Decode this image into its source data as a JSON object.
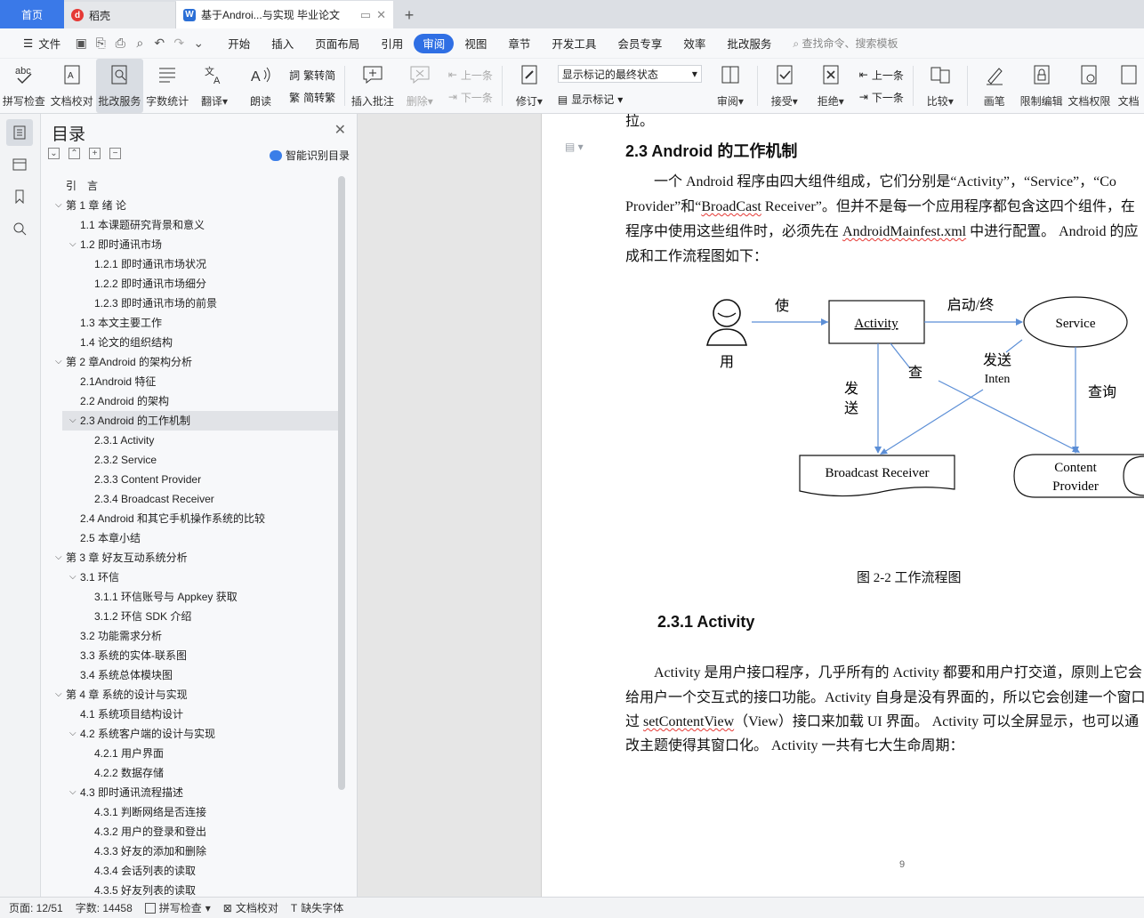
{
  "tabs": {
    "home": "首页",
    "daoke": "稻壳",
    "doc": "基于Androi...与实现 毕业论文",
    "new": "+"
  },
  "menu": {
    "file": "文件",
    "items": [
      "开始",
      "插入",
      "页面布局",
      "引用",
      "审阅",
      "视图",
      "章节",
      "开发工具",
      "会员专享",
      "效率",
      "批改服务"
    ],
    "search": "查找命令、搜索模板"
  },
  "ribbon": {
    "spell": "拼写检查",
    "proof": "文档校对",
    "correct": "批改服务",
    "wordcount": "字数统计",
    "translate": "翻译",
    "read": "朗读",
    "trad": "繁转简",
    "simp": "简转繁",
    "insert_comment": "插入批注",
    "delete": "删除",
    "prev_c": "上一条",
    "next_c": "下一条",
    "revise": "修订",
    "combo": "显示标记的最终状态",
    "show_mark": "显示标记",
    "review": "审阅",
    "accept": "接受",
    "reject": "拒绝",
    "prev": "上一条",
    "next": "下一条",
    "compare": "比较",
    "pen": "画笔",
    "restrict": "限制编辑",
    "perm": "文档权限",
    "more": "文档"
  },
  "toc": {
    "title": "目录",
    "smart": "智能识别目录",
    "items": [
      {
        "t": "引　言",
        "l": 0,
        "tw": ""
      },
      {
        "t": "第 1 章  绪  论",
        "l": 0,
        "tw": "v"
      },
      {
        "t": "1.1 本课题研究背景和意义",
        "l": 1,
        "tw": ""
      },
      {
        "t": "1.2 即时通讯市场",
        "l": 1,
        "tw": "v"
      },
      {
        "t": "1.2.1  即时通讯市场状况",
        "l": 2,
        "tw": ""
      },
      {
        "t": "1.2.2  即时通讯市场细分",
        "l": 2,
        "tw": ""
      },
      {
        "t": "1.2.3  即时通讯市场的前景",
        "l": 2,
        "tw": ""
      },
      {
        "t": "1.3 本文主要工作",
        "l": 1,
        "tw": ""
      },
      {
        "t": "1.4 论文的组织结构",
        "l": 1,
        "tw": ""
      },
      {
        "t": "第 2 章Android 的架构分析",
        "l": 0,
        "tw": "v"
      },
      {
        "t": "2.1Android 特征",
        "l": 1,
        "tw": ""
      },
      {
        "t": "2.2 Android 的架构",
        "l": 1,
        "tw": ""
      },
      {
        "t": "2.3 Android 的工作机制",
        "l": 1,
        "tw": "v",
        "sel": true
      },
      {
        "t": "2.3.1 Activity",
        "l": 2,
        "tw": ""
      },
      {
        "t": "2.3.2 Service",
        "l": 2,
        "tw": ""
      },
      {
        "t": "2.3.3 Content Provider",
        "l": 2,
        "tw": ""
      },
      {
        "t": "2.3.4 Broadcast Receiver",
        "l": 2,
        "tw": ""
      },
      {
        "t": "2.4 Android 和其它手机操作系统的比较",
        "l": 1,
        "tw": ""
      },
      {
        "t": "2.5 本章小结",
        "l": 1,
        "tw": ""
      },
      {
        "t": "第 3 章  好友互动系统分析",
        "l": 0,
        "tw": "v"
      },
      {
        "t": "3.1 环信",
        "l": 1,
        "tw": "v"
      },
      {
        "t": "3.1.1 环信账号与 Appkey 获取",
        "l": 2,
        "tw": ""
      },
      {
        "t": "3.1.2  环信  SDK 介绍",
        "l": 2,
        "tw": ""
      },
      {
        "t": "3.2 功能需求分析",
        "l": 1,
        "tw": ""
      },
      {
        "t": "3.3 系统的实体-联系图",
        "l": 1,
        "tw": ""
      },
      {
        "t": "3.4 系统总体模块图",
        "l": 1,
        "tw": ""
      },
      {
        "t": "第 4 章  系统的设计与实现",
        "l": 0,
        "tw": "v"
      },
      {
        "t": "4.1  系统项目结构设计",
        "l": 1,
        "tw": ""
      },
      {
        "t": "4.2  系统客户端的设计与实现",
        "l": 1,
        "tw": "v"
      },
      {
        "t": "4.2.1 用户界面",
        "l": 2,
        "tw": ""
      },
      {
        "t": "4.2.2  数据存储",
        "l": 2,
        "tw": ""
      },
      {
        "t": "4.3 即时通讯流程描述",
        "l": 1,
        "tw": "v"
      },
      {
        "t": "4.3.1 判断网络是否连接",
        "l": 2,
        "tw": ""
      },
      {
        "t": "4.3.2 用户的登录和登出",
        "l": 2,
        "tw": ""
      },
      {
        "t": "4.3.3 好友的添加和删除",
        "l": 2,
        "tw": ""
      },
      {
        "t": "4.3.4 会话列表的读取",
        "l": 2,
        "tw": ""
      },
      {
        "t": "4.3.5 好友列表的读取",
        "l": 2,
        "tw": ""
      }
    ]
  },
  "doc": {
    "top_frag": "拉。",
    "h23": "2.3 Android 的工作机制",
    "p1": "一个 Android 程序由四大组件组成，它们分别是“Activity”，“Service”，“Co",
    "p2a": "Provider”和“",
    "p2b": "BroadCast",
    "p2c": " Receiver”。但并不是每一个应用程序都包含这四个组件，在",
    "p3a": "程序中使用这些组件时，必须先在 ",
    "p3b": "AndroidMainfest.xml",
    "p3c": " 中进行配置。 Android 的应",
    "p4": "成和工作流程图如下：",
    "caption": "图 2-2  工作流程图",
    "h231": "2.3.1 Activity",
    "q1": "Activity 是用户接口程序，几乎所有的 Activity 都要和用户打交道，原则上它会",
    "q2": "给用户一个交互式的接口功能。Activity 自身是没有界面的，所以它会创建一个窗口",
    "q3a": "过 ",
    "q3b": "setContentView",
    "q3c": "（View）接口来加载 UI 界面。 Activity 可以全屏显示，也可以通",
    "q4": "改主题使得其窗口化。 Activity 一共有七大生命周期：",
    "page_number": "9"
  },
  "diagram": {
    "user_top": "使",
    "user_bottom": "用",
    "activity": "Activity",
    "service": "Service",
    "start_stop": "启动/终",
    "send1": "发",
    "send2": "送",
    "check": "查",
    "send_intent1": "发送",
    "send_intent2": "Inten",
    "query": "查询",
    "broadcast": "Broadcast Receiver",
    "cp1": "Content",
    "cp2": "Provider"
  },
  "status": {
    "page": "页面: 12/51",
    "words": "字数: 14458",
    "spell": "拼写检查",
    "proof": "文档校对",
    "font": "缺失字体"
  }
}
